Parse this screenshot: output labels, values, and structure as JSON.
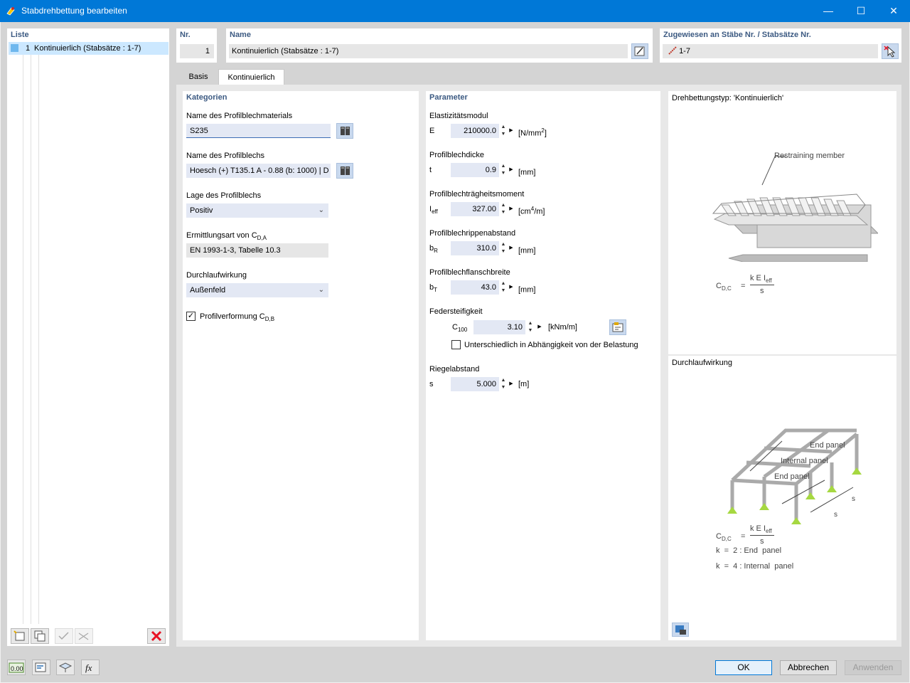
{
  "window": {
    "title": "Stabdrehbettung bearbeiten",
    "minimize": "—",
    "maximize": "☐",
    "close": "✕"
  },
  "liste": {
    "header": "Liste",
    "items": [
      {
        "number": "1",
        "label": "Kontinuierlich (Stabsätze : 1-7)"
      }
    ]
  },
  "top": {
    "nr_label": "Nr.",
    "nr_value": "1",
    "name_label": "Name",
    "name_value": "Kontinuierlich (Stabsätze : 1-7)",
    "assigned_label": "Zugewiesen an Stäbe Nr. / Stabsätze Nr.",
    "assigned_value": "1-7"
  },
  "tabs": [
    {
      "label": "Basis"
    },
    {
      "label": "Kontinuierlich"
    }
  ],
  "kategorien": {
    "header": "Kategorien",
    "material_label": "Name des Profilblechmaterials",
    "material_value": "S235",
    "sheet_label": "Name des Profilblechs",
    "sheet_value": "Hoesch (+) T135.1 A - 0.88 (b: 1000) | D",
    "position_label": "Lage des Profilblechs",
    "position_value": "Positiv",
    "method_label_pre": "Ermittlungsart von C",
    "method_label_sub": "D,A",
    "method_value": "EN 1993-1-3, Tabelle 10.3",
    "continuity_label": "Durchlaufwirkung",
    "continuity_value": "Außenfeld",
    "deformation_label_pre": "Profilverformung C",
    "deformation_label_sub": "D,B",
    "deformation_checked": true
  },
  "parameter": {
    "header": "Parameter",
    "rows": [
      {
        "label": "Elastizitätsmodul",
        "symbol": "E",
        "symbol_sub": "",
        "value": "210000.0",
        "unit_pre": "[N/mm",
        "unit_sup": "2",
        "unit_post": "]"
      },
      {
        "label": "Profilblechdicke",
        "symbol": "t",
        "symbol_sub": "",
        "value": "0.9",
        "unit_pre": "[mm]",
        "unit_sup": "",
        "unit_post": ""
      },
      {
        "label": "Profilblechträgheitsmoment",
        "symbol": "I",
        "symbol_sub": "eff",
        "value": "327.00",
        "unit_pre": "[cm",
        "unit_sup": "4",
        "unit_post": "/m]"
      },
      {
        "label": "Profilblechrippenabstand",
        "symbol": "b",
        "symbol_sub": "R",
        "value": "310.0",
        "unit_pre": "[mm]",
        "unit_sup": "",
        "unit_post": ""
      },
      {
        "label": "Profilblechflanschbreite",
        "symbol": "b",
        "symbol_sub": "T",
        "value": "43.0",
        "unit_pre": "[mm]",
        "unit_sup": "",
        "unit_post": ""
      }
    ],
    "spring_label": "Federsteifigkeit",
    "spring_symbol": "C",
    "spring_symbol_sub": "100",
    "spring_value": "3.10",
    "spring_unit": "[kNm/m]",
    "load_dependent_label": "Unterschiedlich in Abhängigkeit von der Belastung",
    "load_dependent_checked": false,
    "spacing_label": "Riegelabstand",
    "spacing_symbol": "s",
    "spacing_value": "5.000",
    "spacing_unit": "[m]"
  },
  "info": {
    "type_title": "Drehbettungstyp: 'Kontinuierlich'",
    "restraining_label": "Restraining member",
    "formula_lhs": "C",
    "formula_lhs_sub": "D,C",
    "formula_eq": "=",
    "formula_num": "k E I",
    "formula_num_sub": "eff",
    "formula_den": "s",
    "continuity_title": "Durchlaufwirkung",
    "end_panel": "End panel",
    "internal_panel": "Internal panel",
    "s_label": "s",
    "k_end": "k  =  2 : End  panel",
    "k_internal": "k  =  4 : Internal  panel"
  },
  "buttons": {
    "ok": "OK",
    "cancel": "Abbrechen",
    "apply": "Anwenden"
  },
  "icons": {
    "units": "0.00"
  },
  "colors": {
    "titlebar": "#0078d7",
    "section": "#3c5a82",
    "input": "#e3e8f4",
    "delete": "#e81123"
  }
}
